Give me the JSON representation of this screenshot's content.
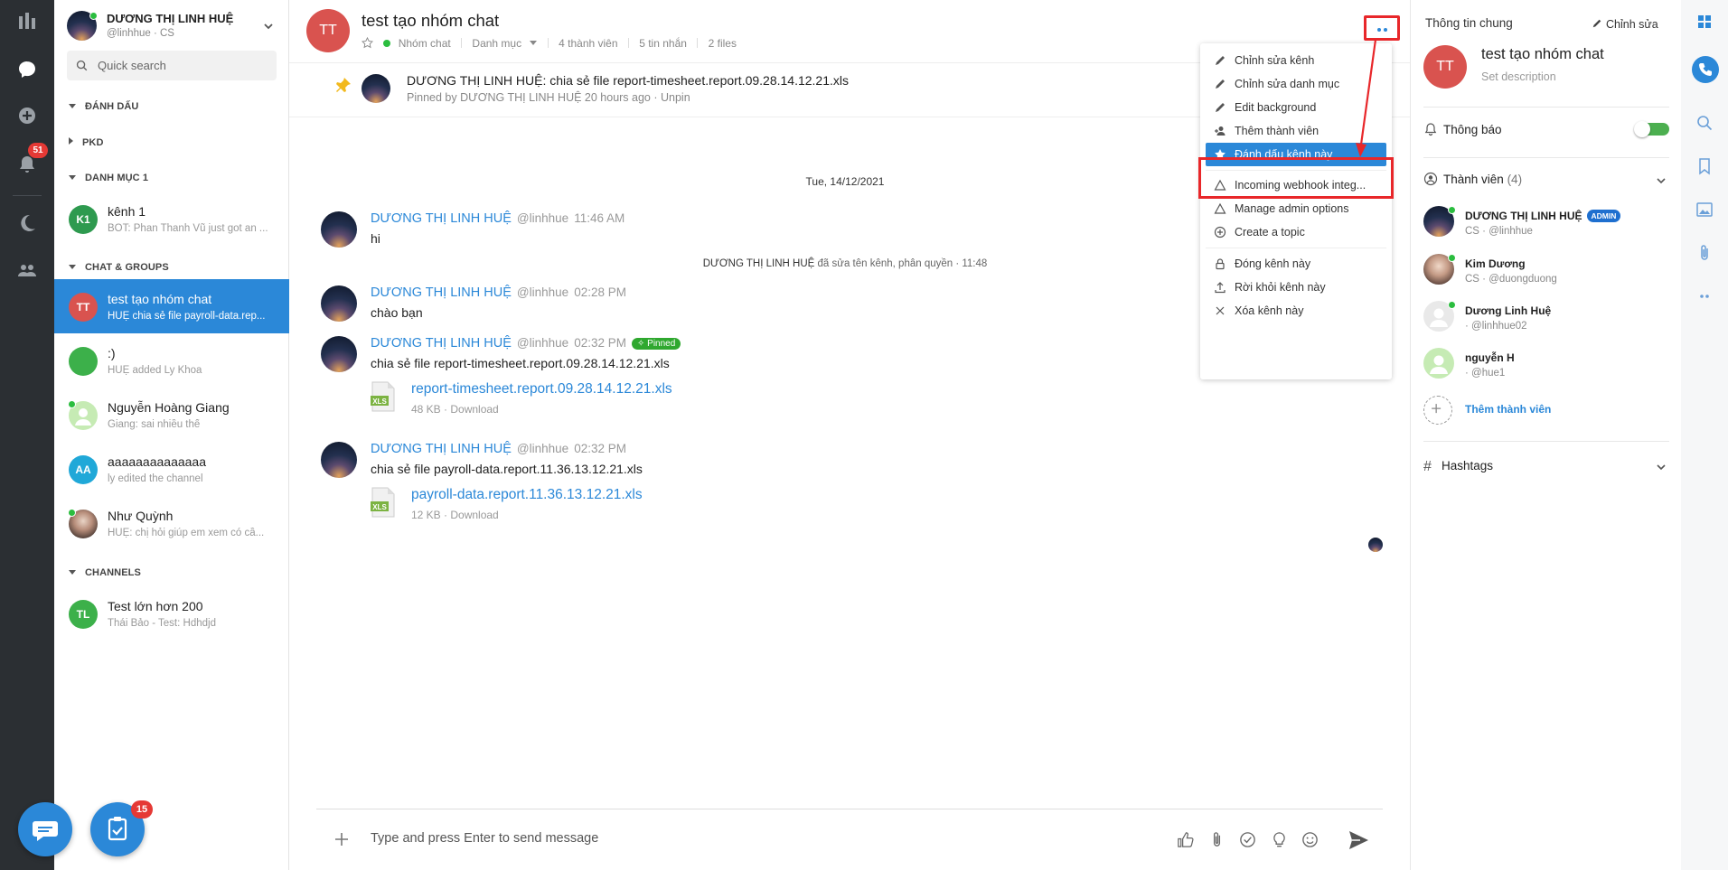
{
  "rail": {
    "notification_count": "51"
  },
  "user": {
    "name": "DƯƠNG THỊ LINH HUỆ",
    "handle": "@linhhue · CS"
  },
  "search": {
    "placeholder": "Quick search"
  },
  "sections": {
    "favorites": "ĐÁNH DẤU",
    "pkd": "PKD",
    "category1": "DANH MỤC 1",
    "chat_groups": "CHAT & GROUPS",
    "channels": "CHANNELS"
  },
  "conversations": [
    {
      "initials": "K1",
      "name": "kênh 1",
      "preview": "BOT: Phan Thanh Vũ just got an ...",
      "color": "#2e9a4f"
    },
    {
      "initials": "TT",
      "name": "test tạo nhóm chat",
      "preview": "HUỆ chia sẻ file payroll-data.rep...",
      "color": "#d9534f"
    },
    {
      "initials": "",
      "name": ":)",
      "preview": "HUỆ added Ly Khoa",
      "color": "#3cb04a"
    },
    {
      "initials": "",
      "name": "Nguyễn Hoàng Giang",
      "preview": "Giang: sai nhiều thế",
      "color": "#b7e3a5"
    },
    {
      "initials": "AA",
      "name": "aaaaaaaaaaaaaa",
      "preview": "ly edited the channel",
      "color": "#20a8d8"
    },
    {
      "initials": "",
      "name": "Như Quỳnh",
      "preview": "HUỆ: chị hỏi giúp em xem có cầ...",
      "color": "#caa99a"
    },
    {
      "initials": "TL",
      "name": "Test lớn hơn 200",
      "preview": "Thái Bảo - Test: Hdhdjd",
      "color": "#3cb04a"
    }
  ],
  "fab": {
    "tasks_count": "15"
  },
  "header": {
    "initials": "TT",
    "title": "test tạo nhóm chat",
    "type": "Nhóm chat",
    "category": "Danh mục",
    "members": "4 thành viên",
    "messages": "5 tin nhắn",
    "files": "2 files"
  },
  "pinned": {
    "text": "DƯƠNG THỊ LINH HUỆ: chia sẻ file report-timesheet.report.09.28.14.12.21.xls",
    "meta": "Pinned by DƯƠNG THỊ LINH HUỆ 20 hours ago · Unpin"
  },
  "date_separator": "Tue, 14/12/2021",
  "system_message": {
    "actor": "DƯƠNG THỊ LINH HUỆ",
    "text": " đã sửa tên kênh, phân quyền · 11:48"
  },
  "messages": [
    {
      "name": "DƯƠNG THỊ LINH HUỆ",
      "handle": "@linhhue",
      "time": "11:46 AM",
      "text": "hi"
    },
    {
      "name": "DƯƠNG THỊ LINH HUỆ",
      "handle": "@linhhue",
      "time": "02:28 PM",
      "text": "chào bạn"
    },
    {
      "name": "DƯƠNG THỊ LINH HUỆ",
      "handle": "@linhhue",
      "time": "02:32 PM",
      "badge": "Pinned",
      "text": "chia sẻ file report-timesheet.report.09.28.14.12.21.xls",
      "file": {
        "name": "report-timesheet.report.09.28.14.12.21.xls",
        "meta": "48 KB · Download"
      }
    },
    {
      "name": "DƯƠNG THỊ LINH HUỆ",
      "handle": "@linhhue",
      "time": "02:32 PM",
      "text": "chia sẻ file payroll-data.report.11.36.13.12.21.xls",
      "file": {
        "name": "payroll-data.report.11.36.13.12.21.xls",
        "meta": "12 KB · Download"
      }
    }
  ],
  "composer": {
    "placeholder": "Type and press Enter to send message"
  },
  "menu": [
    {
      "label": "Chỉnh sửa kênh",
      "icon": "pencil-icon"
    },
    {
      "label": "Chỉnh sửa danh mục",
      "icon": "pencil-icon"
    },
    {
      "label": "Edit background",
      "icon": "pencil-icon"
    },
    {
      "label": "Thêm thành viên",
      "icon": "add-user-icon"
    },
    {
      "label": "Đánh dấu kênh này",
      "icon": "star-icon",
      "selected": true
    },
    {
      "label": "Incoming webhook integ...",
      "icon": "triangle-icon"
    },
    {
      "label": "Manage admin options",
      "icon": "triangle-icon"
    },
    {
      "label": "Create a topic",
      "icon": "plus-circle-icon"
    },
    {
      "label": "Đóng kênh này",
      "icon": "lock-icon"
    },
    {
      "label": "Rời khỏi kênh này",
      "icon": "upload-icon"
    },
    {
      "label": "Xóa kênh này",
      "icon": "close-icon"
    }
  ],
  "info": {
    "title": "Thông tin chung",
    "edit": "Chỉnh sửa",
    "initials": "TT",
    "name": "test tạo nhóm chat",
    "description_placeholder": "Set description",
    "notify": "Thông báo",
    "members_label": "Thành viên",
    "members_count": "(4)",
    "add_member": "Thêm thành viên",
    "hashtags": "Hashtags"
  },
  "members": [
    {
      "name": "DƯƠNG THỊ LINH HUỆ",
      "sub": "CS · @linhhue",
      "badge": "ADMIN"
    },
    {
      "name": "Kim Dương",
      "sub": "CS · @duongduong"
    },
    {
      "name": "Dương Linh Huệ",
      "sub": "· @linhhue02"
    },
    {
      "name": "nguyễn H",
      "sub": "· @hue1"
    }
  ],
  "colors": {
    "accent": "#2b88d8",
    "highlight": "#e8272a",
    "online": "#2bbd3f",
    "rail": "#2b2f33"
  }
}
